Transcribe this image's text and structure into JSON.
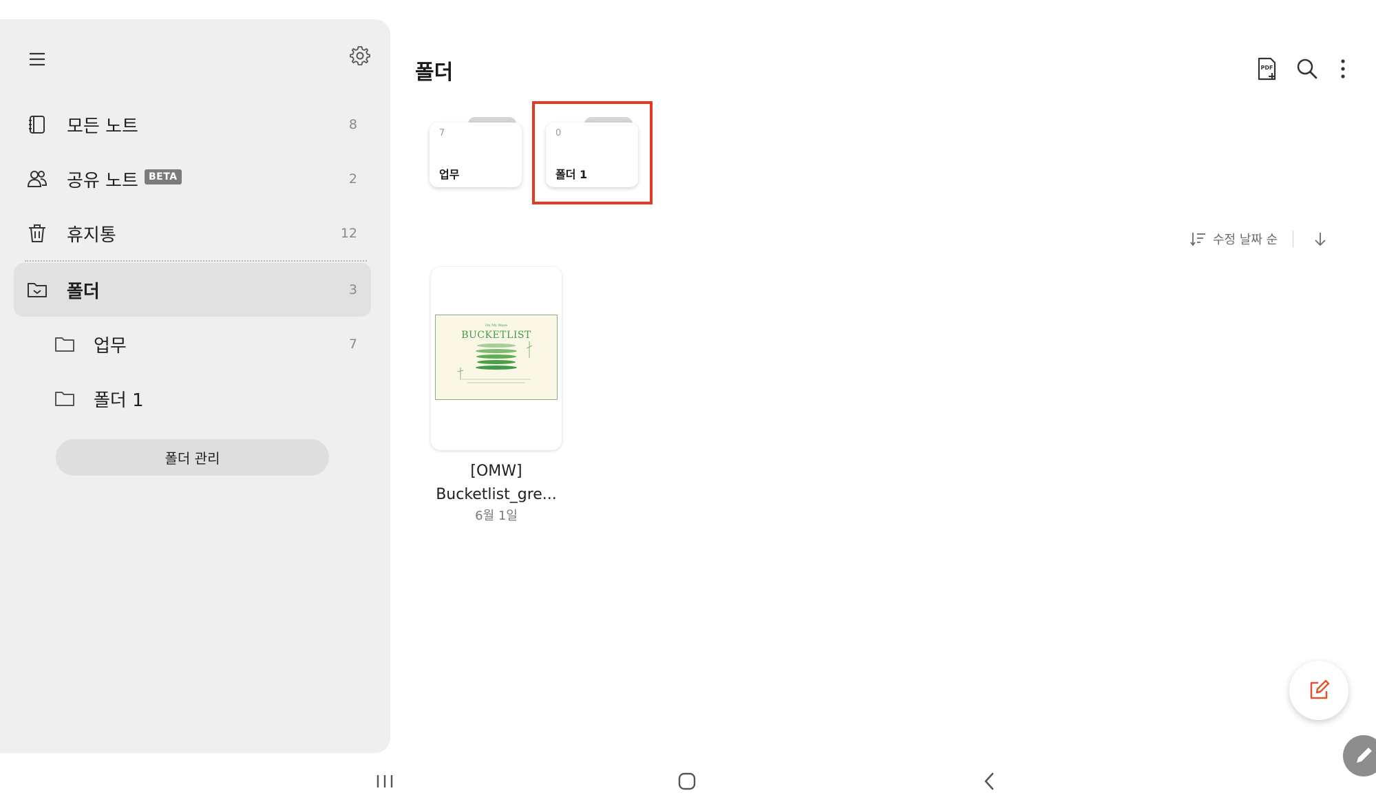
{
  "sidebar": {
    "items": [
      {
        "label": "모든 노트",
        "count": "8",
        "icon": "notebook-icon"
      },
      {
        "label": "공유 노트",
        "badge": "BETA",
        "count": "2",
        "icon": "people-icon"
      },
      {
        "label": "휴지통",
        "count": "12",
        "icon": "trash-icon"
      },
      {
        "label": "폴더",
        "count": "3",
        "icon": "folder-check-icon",
        "active": true
      },
      {
        "label": "업무",
        "count": "7",
        "icon": "folder-icon"
      },
      {
        "label": "폴더 1",
        "count": "",
        "icon": "folder-icon"
      }
    ],
    "manage_button": "폴더 관리"
  },
  "header": {
    "title": "폴더",
    "actions": [
      "pdf-add-icon",
      "search-icon",
      "more-icon"
    ]
  },
  "folders": [
    {
      "name": "업무",
      "count": "7"
    },
    {
      "name": "폴더 1",
      "count": "0",
      "highlighted": true
    }
  ],
  "sort": {
    "label": "수정 날짜 순",
    "direction": "descending"
  },
  "notes": [
    {
      "title_line1": "[OMW]",
      "title_line2": "Bucketlist_gre...",
      "date": "6월 1일",
      "thumb_small": "On My Wave",
      "thumb_title": "BUCKETLIST"
    }
  ],
  "colors": {
    "sidebar_bg": "#efefef",
    "active_item_bg": "#e1e1e1",
    "highlight": "#e33b22",
    "fab_icon": "#e0532f",
    "thumb_green": "#3f9a4c"
  }
}
